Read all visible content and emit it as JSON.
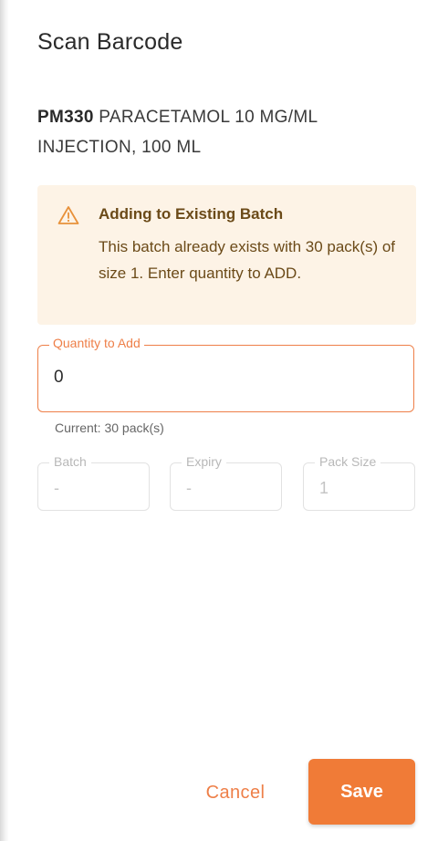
{
  "dialog": {
    "title": "Scan Barcode",
    "product_code": "PM330",
    "product_name": "PARACETAMOL 10 MG/ML INJECTION, 100 ML"
  },
  "alert": {
    "icon": "warning-triangle-icon",
    "title": "Adding to Existing Batch",
    "message": "This batch already exists with 30 pack(s) of size 1. Enter quantity to ADD."
  },
  "quantity": {
    "label": "Quantity to Add",
    "value": "0",
    "helper": "Current: 30 pack(s)"
  },
  "fields": {
    "batch": {
      "label": "Batch",
      "value": "-"
    },
    "expiry": {
      "label": "Expiry",
      "value": "-"
    },
    "pack_size": {
      "label": "Pack Size",
      "value": "1"
    }
  },
  "actions": {
    "cancel_label": "Cancel",
    "save_label": "Save"
  },
  "colors": {
    "accent": "#f07b37",
    "alert_background": "#fdf3e6",
    "alert_text": "#6b4a18"
  }
}
